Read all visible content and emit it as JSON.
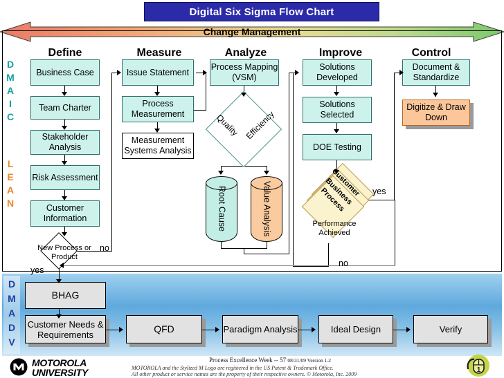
{
  "title": "Digital Six Sigma Flow Chart",
  "change_management": {
    "label": "Change Management",
    "left_color": "#f08a78",
    "mid_color": "#ead98a",
    "right_color": "#8bd07e"
  },
  "phase_letters": {
    "dmaic": [
      "D",
      "M",
      "A",
      "I",
      "C"
    ],
    "lean": [
      "L",
      "E",
      "A",
      "N"
    ],
    "dmadv": [
      "D",
      "M",
      "A",
      "D",
      "V"
    ],
    "dmaic_color": "#19a0a0",
    "lean_color": "#e8862a",
    "dmadv_color": "#1c3f9e"
  },
  "columns": [
    {
      "header": "Define",
      "nodes": [
        "Business Case",
        "Team Charter",
        "Stakeholder Analysis",
        "Risk Assessment",
        "Customer Information"
      ],
      "decision": "New Process or Product",
      "decision_yes": "yes",
      "decision_no": "no"
    },
    {
      "header": "Measure",
      "nodes": [
        "Issue Statement",
        "Process Measurement"
      ],
      "white_node": "Measurement Systems Analysis"
    },
    {
      "header": "Analyze",
      "nodes": [
        "Process Mapping (VSM)"
      ],
      "diamond_left": "Quality",
      "diamond_right": "Efficiency",
      "cylinders": [
        "Root Cause",
        "Value Analysis"
      ]
    },
    {
      "header": "Improve",
      "nodes": [
        "Solutions Developed",
        "Solutions Selected",
        "DOE Testing"
      ],
      "stacked_diamonds": [
        "Customer",
        "Business",
        "Process"
      ],
      "decision": "Performance Achieved",
      "decision_yes": "yes",
      "decision_no": "no"
    },
    {
      "header": "Control",
      "nodes": [
        "Document & Standardize"
      ],
      "orange_node": "Digitize & Draw Down"
    }
  ],
  "dmadv_row": {
    "bhag": "BHAG",
    "steps": [
      "Customer Needs & Requirements",
      "QFD",
      "Paradigm Analysis",
      "Ideal Design",
      "Verify"
    ]
  },
  "footer": {
    "logo_line1": "MOTOROLA",
    "logo_line2": "UNIVERSITY",
    "line1": "Process Excellence Week -- 57",
    "line1_small": "08/31/09 Version 1.2",
    "line2": "MOTOROLA and the Stylized M Logo are registered in the US Patent & Trademark Office.",
    "line3": "All other product or service names are the property of their respective owners. © Motorola, Inc. 2009",
    "mouse_badge": "1"
  }
}
